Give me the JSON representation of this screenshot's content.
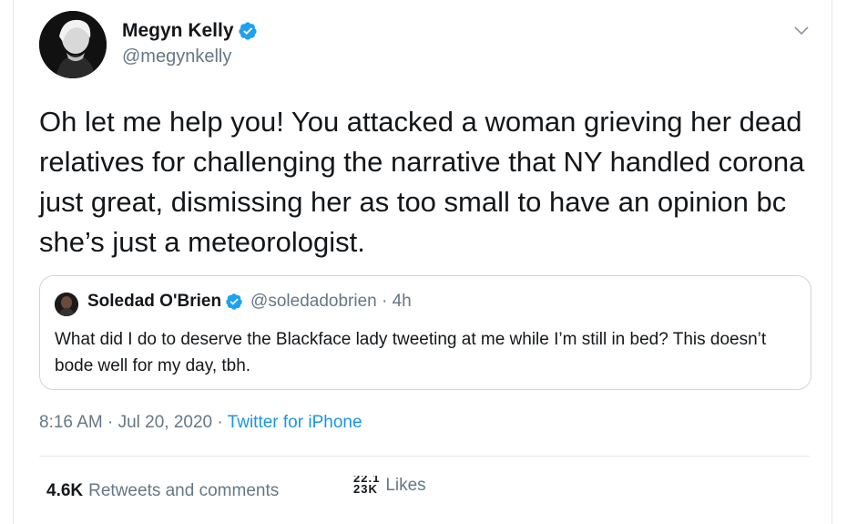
{
  "tweet": {
    "author_name": "Megyn Kelly",
    "author_handle": "@megynkelly",
    "text": "Oh let me help you! You attacked a woman grieving her dead relatives for challenging the narrative that NY handled corona just great, dismissing her as too small to have an opinion bc she’s just a meteorologist.",
    "timestamp": "8:16 AM · Jul 20, 2020 · ",
    "source": "Twitter for iPhone"
  },
  "quote": {
    "author_name": "Soledad O'Brien",
    "author_handle": "@soledadobrien · 4h",
    "text": "What did I do to deserve the Blackface lady tweeting at me while I’m still in bed? This doesn’t bode well for my day, tbh."
  },
  "stats": {
    "retweets_count": "4.6K",
    "retweets_label": "Retweets and comments",
    "likes_count_old": "22.1",
    "likes_count": "23K",
    "likes_label": "Likes"
  },
  "colors": {
    "verified": "#1da1f2",
    "link": "#1b95e0",
    "muted": "#657786"
  },
  "icons": {
    "verified": "verified-badge-icon",
    "menu": "chevron-down-icon"
  }
}
